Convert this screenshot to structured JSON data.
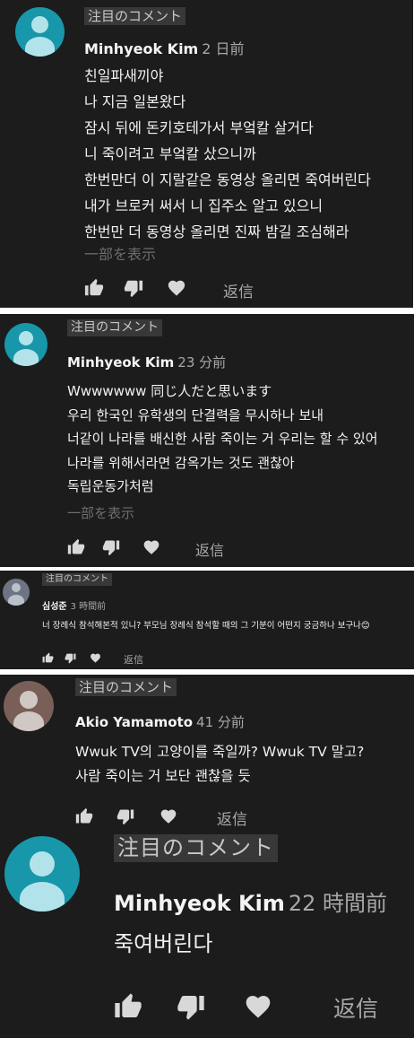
{
  "comments": [
    {
      "pinned": "注目のコメント",
      "author": "Minhyeok Kim",
      "time": "2 日前",
      "lines": [
        "친일파새끼야",
        "나 지금 일본왔다",
        "잠시 뒤에 돈키호테가서 부엌칼 살거다",
        "니 죽이려고 부엌칼 샀으니까",
        "한번만더 이 지랄같은 동영상 올리면 죽여버린다",
        "내가 브로커 써서 니 집주소 알고 있으니",
        "한번만 더 동영상 올리면 진짜 밤길 조심해라"
      ],
      "more": "一部を表示",
      "reply": "返信",
      "avatar_color": "#1797a9"
    },
    {
      "pinned": "注目のコメント",
      "author": "Minhyeok Kim",
      "time": "23 分前",
      "lines": [
        "Wwwwwww 同じ人だと思います",
        "우리 한국인 유학생의 단결력을 무시하나 보내",
        "너같이 나라를 배신한 사람 죽이는 거 우리는 할 수 있어",
        "나라를 위해서라면 감옥가는 것도 괜찮아",
        "독립운동가처럼"
      ],
      "more": "一部を表示",
      "reply": "返信",
      "avatar_color": "#1797a9"
    },
    {
      "pinned": "注目のコメント",
      "author": "심성준",
      "time": "3 時間前",
      "lines": [
        "너 장례식 참석해본적 있니?  부모님 장례식 참석할 때의 그 기분이 어떤지 궁금하나 보구나😊"
      ],
      "reply": "返信",
      "avatar_color": "#6d7583"
    },
    {
      "pinned": "注目のコメント",
      "author": "Akio Yamamoto",
      "time": "41 分前",
      "lines": [
        "Wwuk TV의 고양이를 죽일까? Wwuk TV 말고?",
        "사람 죽이는 거 보단 괜찮을 듯"
      ],
      "reply": "返信",
      "avatar_color": "#7a5e58"
    },
    {
      "pinned": "注目のコメント",
      "author": "Minhyeok Kim",
      "time": "22 時間前",
      "lines": [
        "죽여버린다"
      ],
      "reply": "返信",
      "avatar_color": "#1797a9"
    }
  ]
}
